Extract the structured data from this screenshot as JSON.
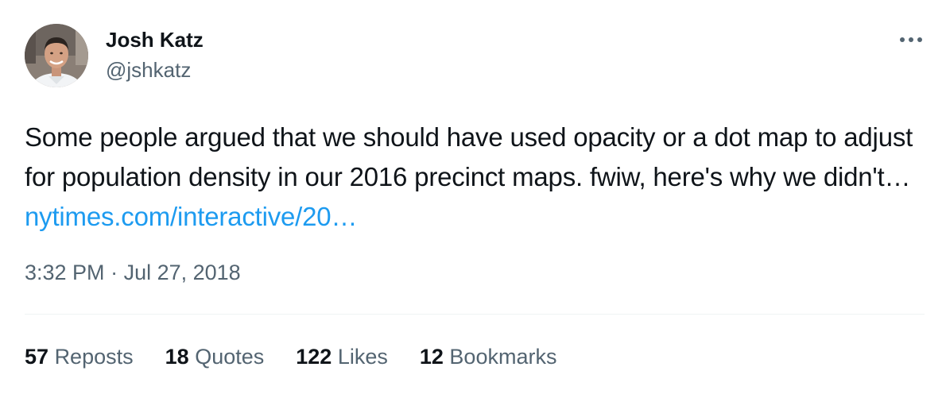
{
  "author": {
    "display_name": "Josh Katz",
    "handle": "@jshkatz"
  },
  "tweet": {
    "text": "Some people argued that we should have used opacity or a dot map to adjust for population density in our 2016 precinct maps. fwiw, here's why we didn't…",
    "link_text": "nytimes.com/interactive/20…"
  },
  "meta": {
    "time": "3:32 PM",
    "separator": " · ",
    "date": "Jul 27, 2018"
  },
  "stats": [
    {
      "count": "57",
      "label": "Reposts"
    },
    {
      "count": "18",
      "label": "Quotes"
    },
    {
      "count": "122",
      "label": "Likes"
    },
    {
      "count": "12",
      "label": "Bookmarks"
    }
  ],
  "icons": {
    "more": "more-options-icon",
    "avatar": "profile-photo"
  },
  "colors": {
    "text": "#0f1419",
    "secondary": "#536471",
    "link": "#1d9bf0",
    "divider": "#eff3f4"
  }
}
